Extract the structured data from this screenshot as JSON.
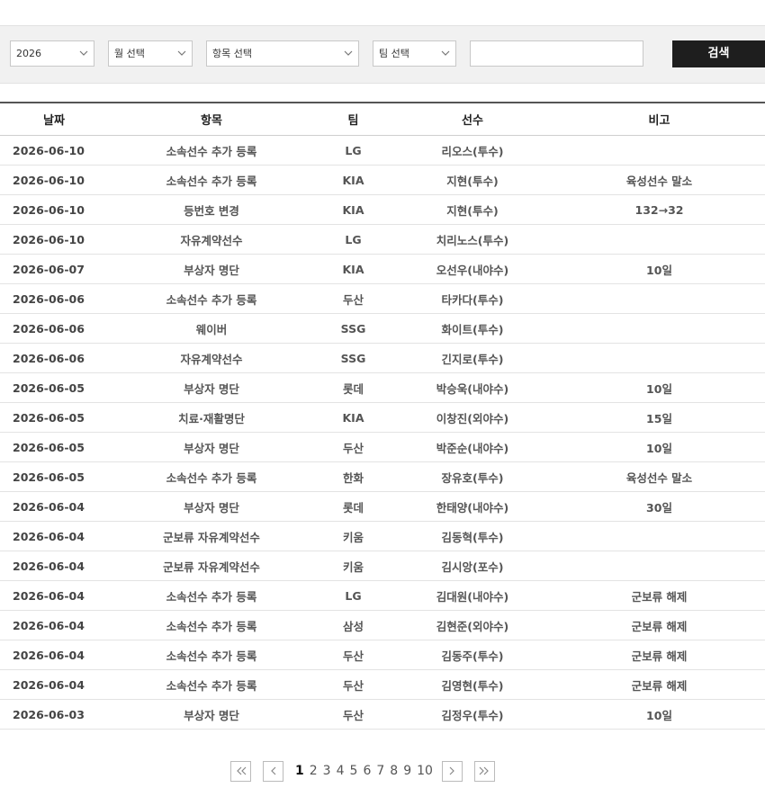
{
  "filters": {
    "year": "2026",
    "month": "월 선택",
    "category": "항목 선택",
    "team": "팀 선택",
    "search_value": "",
    "search_button": "검색"
  },
  "table": {
    "headers": [
      "날짜",
      "항목",
      "팀",
      "선수",
      "비고"
    ],
    "rows": [
      [
        "2026-06-10",
        "소속선수 추가 등록",
        "LG",
        "리오스(투수)",
        ""
      ],
      [
        "2026-06-10",
        "소속선수 추가 등록",
        "KIA",
        "지현(투수)",
        "육성선수 말소"
      ],
      [
        "2026-06-10",
        "등번호 변경",
        "KIA",
        "지현(투수)",
        "132→32"
      ],
      [
        "2026-06-10",
        "자유계약선수",
        "LG",
        "치리노스(투수)",
        ""
      ],
      [
        "2026-06-07",
        "부상자 명단",
        "KIA",
        "오선우(내야수)",
        "10일"
      ],
      [
        "2026-06-06",
        "소속선수 추가 등록",
        "두산",
        "타카다(투수)",
        ""
      ],
      [
        "2026-06-06",
        "웨이버",
        "SSG",
        "화이트(투수)",
        ""
      ],
      [
        "2026-06-06",
        "자유계약선수",
        "SSG",
        "긴지로(투수)",
        ""
      ],
      [
        "2026-06-05",
        "부상자 명단",
        "롯데",
        "박승욱(내야수)",
        "10일"
      ],
      [
        "2026-06-05",
        "치료·재활명단",
        "KIA",
        "이창진(외야수)",
        "15일"
      ],
      [
        "2026-06-05",
        "부상자 명단",
        "두산",
        "박준순(내야수)",
        "10일"
      ],
      [
        "2026-06-05",
        "소속선수 추가 등록",
        "한화",
        "장유호(투수)",
        "육성선수 말소"
      ],
      [
        "2026-06-04",
        "부상자 명단",
        "롯데",
        "한태양(내야수)",
        "30일"
      ],
      [
        "2026-06-04",
        "군보류 자유계약선수",
        "키움",
        "김동혁(투수)",
        ""
      ],
      [
        "2026-06-04",
        "군보류 자유계약선수",
        "키움",
        "김시앙(포수)",
        ""
      ],
      [
        "2026-06-04",
        "소속선수 추가 등록",
        "LG",
        "김대원(내야수)",
        "군보류 해제"
      ],
      [
        "2026-06-04",
        "소속선수 추가 등록",
        "삼성",
        "김현준(외야수)",
        "군보류 해제"
      ],
      [
        "2026-06-04",
        "소속선수 추가 등록",
        "두산",
        "김동주(투수)",
        "군보류 해제"
      ],
      [
        "2026-06-04",
        "소속선수 추가 등록",
        "두산",
        "김영현(투수)",
        "군보류 해제"
      ],
      [
        "2026-06-03",
        "부상자 명단",
        "두산",
        "김정우(투수)",
        "10일"
      ]
    ]
  },
  "pagination": {
    "first_icon": "double-chevron-left-icon",
    "prev_icon": "chevron-left-icon",
    "pages": [
      "1",
      "2",
      "3",
      "4",
      "5",
      "6",
      "7",
      "8",
      "9",
      "10"
    ],
    "current": "1",
    "next_icon": "chevron-right-icon",
    "last_icon": "double-chevron-right-icon"
  }
}
